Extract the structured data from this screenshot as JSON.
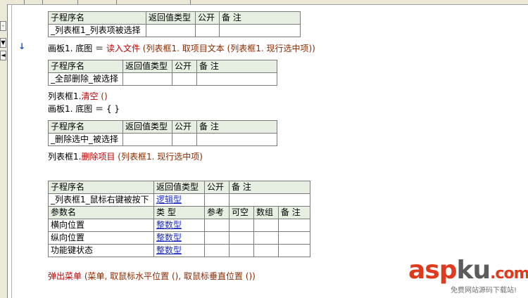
{
  "window": {
    "collapse_glyph": "-",
    "dropdown_glyph": "▼",
    "scroll_glyph": "◄"
  },
  "marker_symbol": "↓",
  "headers": {
    "sub_name": "子程序名",
    "return_type": "返回值类型",
    "public": "公开",
    "remark": "备 注",
    "param_name": "参数名",
    "type": "类 型",
    "ref": "参考",
    "nullable": "可空",
    "array": "数组"
  },
  "sub1": {
    "name": "_列表框1_列表项被选择",
    "return_type": "",
    "public": "",
    "remark": ""
  },
  "code1": {
    "obj": "画板1. 底图",
    "eq": "＝",
    "func": "读入文件",
    "args": "(列表框1. 取项目文本 (列表框1. 现行选中项))"
  },
  "sub2": {
    "name": "_全部删除_被选择",
    "return_type": "",
    "public": "",
    "remark": ""
  },
  "code2": {
    "obj": "列表框1.",
    "func": "清空",
    "args": "()"
  },
  "code3": {
    "obj": "画板1. 底图",
    "eq": "＝",
    "args": "{ }"
  },
  "sub3": {
    "name": "_删除选中_被选择",
    "return_type": "",
    "public": "",
    "remark": ""
  },
  "code4": {
    "obj": "列表框1.",
    "func": "删除项目",
    "args": "(列表框1. 现行选中项)"
  },
  "sub4": {
    "name": "_列表框1_鼠标右键被按下",
    "return_type": "逻辑型",
    "public": "",
    "remark": "",
    "params": [
      {
        "name": "横向位置",
        "type": "整数型"
      },
      {
        "name": "纵向位置",
        "type": "整数型"
      },
      {
        "name": "功能键状态",
        "type": "整数型"
      }
    ]
  },
  "code5": {
    "func": "弹出菜单",
    "args": "(菜单, 取鼠标水平位置 (), 取鼠标垂直位置 ())"
  },
  "watermark": {
    "brand_a": "asp",
    "brand_b": "ku",
    "brand_c": ".com",
    "tagline": "免费网站源码下载站!"
  },
  "colors": {
    "header_bg": "#e6efe2",
    "keyword_red": "#c00000",
    "link_blue": "#1f2fc0"
  }
}
